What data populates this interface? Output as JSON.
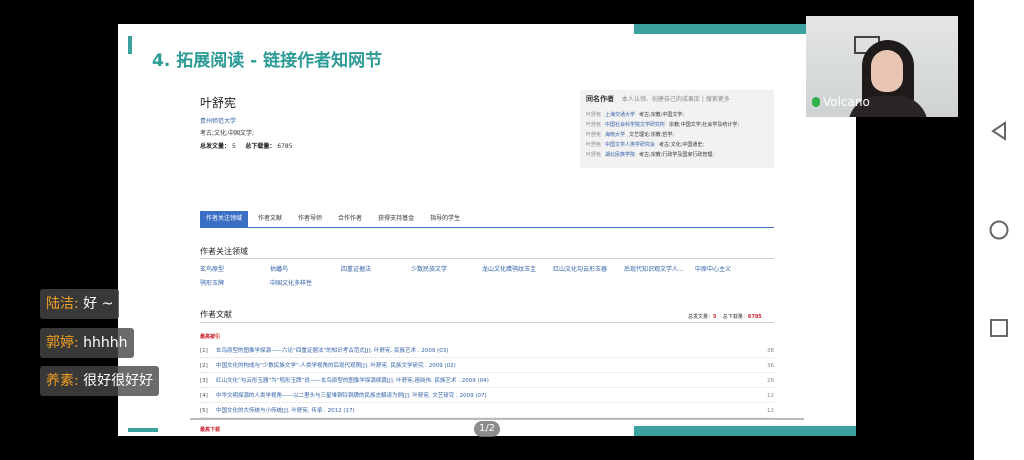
{
  "slide": {
    "title": "4. 拓展阅读 - 链接作者知网节",
    "page_indicator": "1/2"
  },
  "author": {
    "name": "叶舒宪",
    "institution": "贵州师范大学",
    "subjects": "考古;文化;中国文学;",
    "total_label": "总发文量：",
    "total_value": "5",
    "downloads_label": "总下载量：",
    "downloads_value": "6785"
  },
  "same_name": {
    "title": "同名作者",
    "hint": "本人认领、创建自己的成果库",
    "sep": "|",
    "more": "搜索更多",
    "rows": [
      {
        "name": "叶舒宪",
        "unit": "上海交通大学",
        "fields": "考古;宗教;中国文学;"
      },
      {
        "name": "叶舒宪",
        "unit": "中国社会科学院文学研究所",
        "fields": "宗教;中国文学;社会学及统计学;"
      },
      {
        "name": "叶舒宪",
        "unit": "海南大学",
        "fields": "文艺理论;宗教;哲学;"
      },
      {
        "name": "叶舒宪",
        "unit": "中国文学人类学研究会",
        "fields": "考古;文化;中国通史;"
      },
      {
        "name": "叶舒宪",
        "unit": "湖北民族学院",
        "fields": "考古;宗教;行政学及国家行政管理;"
      }
    ]
  },
  "tabs": [
    "作者关注领域",
    "作者文献",
    "作者导师",
    "合作作者",
    "获得支持基金",
    "指导的学生"
  ],
  "focus": {
    "title": "作者关注领域",
    "items": [
      "玄鸟原型",
      "祜蟠鸟",
      "四重证据法",
      "少数民族文学",
      "龙山文化鹰鸮纹玉圭",
      "红山文化勾云形玉器",
      "后现代知识观文学人...",
      "中原中心主义",
      "鸮形玉牌",
      "中国文化多样性"
    ]
  },
  "literature": {
    "title": "作者文献",
    "total_label": "总发文量：",
    "total_value": "5",
    "downloads_label": "总下载量：",
    "downloads_value": "6785",
    "cited_label": "最高被引",
    "download_top_label": "最高下载",
    "items": [
      {
        "no": "[1]",
        "title": "玄鸟原型的图像学探源——六论“四重证据法”的知识考古范式[J]. 叶舒宪. 民族艺术 . 2009 (03)",
        "count": "38"
      },
      {
        "no": "[2]",
        "title": "中国文化的构成与“少数民族文学”:人类学视角的后现代观照[J]. 叶舒宪. 民族文学研究 . 2009 (02)",
        "count": "36"
      },
      {
        "no": "[3]",
        "title": "红山文化“勾云形玉器”为“鸮形玉牌”说——玄鸟原型的图像学探源续篇[J]. 叶舒宪,祖晓伟. 民族艺术 . 2009 (04)",
        "count": "26"
      },
      {
        "no": "[4]",
        "title": "中华文明探源的人类学视角——以二里头与三星堆铜铃铜牌的民族志解读为例[J]. 叶舒宪. 文艺研究 . 2009 (07)",
        "count": "12"
      },
      {
        "no": "[5]",
        "title": "中国文化的大传统与小传统[J]. 叶舒宪. 传承 . 2012 (17)",
        "count": "12"
      }
    ]
  },
  "video": {
    "name": "Volcano"
  },
  "chat": [
    {
      "user": "陆洁:",
      "message": " 好 ~"
    },
    {
      "user": "郭婷:",
      "message": " hhhhh"
    },
    {
      "user": "养素:",
      "message": " 很好很好好"
    }
  ],
  "nav_icons": [
    "back-icon",
    "home-icon",
    "recents-icon"
  ],
  "colors": {
    "accent": "#2c9b96",
    "link": "#2f5fa8",
    "tab_active": "#3b6fc4",
    "chat_user": "#f0a020"
  }
}
